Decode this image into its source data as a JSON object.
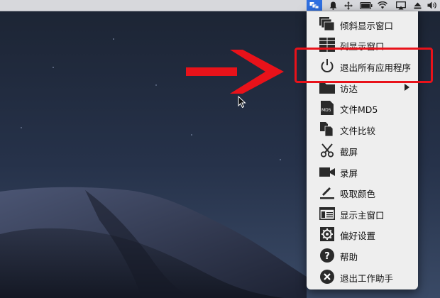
{
  "menu": {
    "items": [
      {
        "label": "倾斜显示窗口",
        "icon": "tilted-windows-icon"
      },
      {
        "label": "列显示窗口",
        "icon": "column-windows-icon"
      },
      {
        "label": "退出所有应用程序",
        "icon": "power-icon"
      },
      {
        "label": "访达",
        "icon": "folder-icon",
        "has_submenu": true
      },
      {
        "label": "文件MD5",
        "icon": "md5-file-icon",
        "icon_text": "MD5"
      },
      {
        "label": "文件比较",
        "icon": "file-compare-icon"
      },
      {
        "label": "截屏",
        "icon": "scissors-icon"
      },
      {
        "label": "录屏",
        "icon": "video-camera-icon"
      },
      {
        "label": "吸取颜色",
        "icon": "color-picker-icon"
      },
      {
        "label": "显示主窗口",
        "icon": "main-window-icon"
      },
      {
        "label": "偏好设置",
        "icon": "gear-icon"
      },
      {
        "label": "帮助",
        "icon": "help-icon",
        "icon_text": "?"
      },
      {
        "label": "退出工作助手",
        "icon": "close-circle-icon"
      }
    ]
  },
  "menubar": {
    "icons": [
      "app-toolbox-icon",
      "bell-icon",
      "move-icon",
      "battery-icon",
      "wifi-icon",
      "airplay-icon",
      "eject-icon",
      "volume-icon"
    ]
  },
  "annotation": {
    "highlighted_item": "退出所有应用程序",
    "color": "#e8121a"
  }
}
